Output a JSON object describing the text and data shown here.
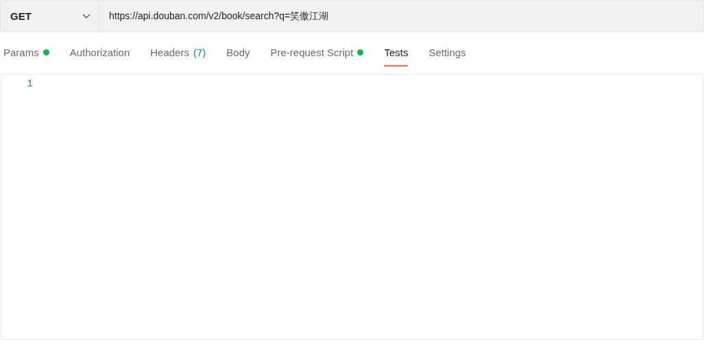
{
  "request": {
    "method": "GET",
    "url": "https://api.douban.com/v2/book/search?q=笑傲江湖"
  },
  "tabs": [
    {
      "label": "Params",
      "indicator": true,
      "selected": false
    },
    {
      "label": "Authorization",
      "indicator": false,
      "selected": false
    },
    {
      "label": "Headers",
      "count": "(7)",
      "indicator": false,
      "selected": false
    },
    {
      "label": "Body",
      "indicator": false,
      "selected": false
    },
    {
      "label": "Pre-request Script",
      "indicator": true,
      "selected": false
    },
    {
      "label": "Tests",
      "indicator": false,
      "selected": true
    },
    {
      "label": "Settings",
      "indicator": false,
      "selected": false
    }
  ],
  "editor": {
    "line_numbers": [
      "1"
    ]
  }
}
